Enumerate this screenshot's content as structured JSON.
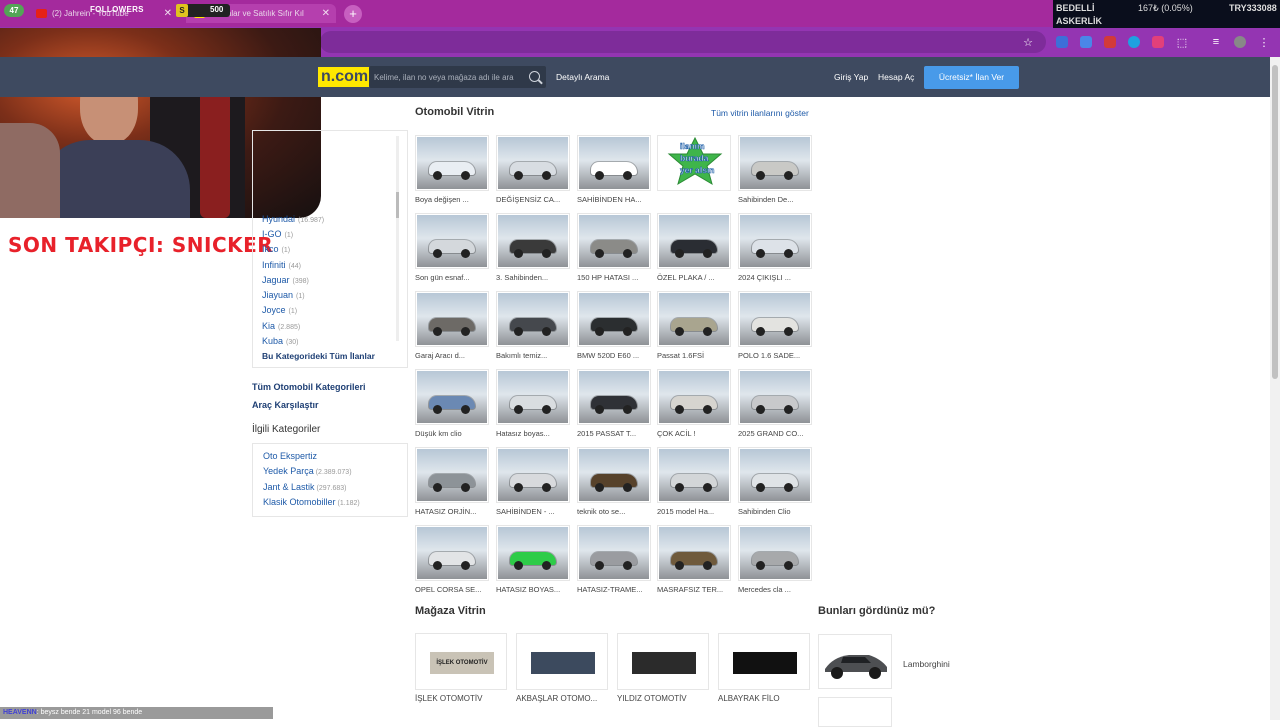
{
  "browser": {
    "tabs": [
      {
        "title": "(2) Jahrein - YouTube",
        "favicon_color": "#e62117"
      },
      {
        "title": "Arabalar ve Satılık Sıfır Kıl",
        "favicon_color": "#ffe800"
      }
    ],
    "new_tab_label": "+",
    "tab_close_label": "✕"
  },
  "overlay": {
    "followers_count": "47",
    "followers_label": "FOLLOWERS",
    "goal_icon_label": "S",
    "goal_value": "500",
    "ticker": {
      "name_line1": "BEDELLİ",
      "name_line2": "ASKERLİK",
      "change": "167₺ (0.05%)",
      "price": "TRY333088"
    },
    "last_follower": "SON TAKIPÇI: SNICKER",
    "chat": {
      "user": "HEAVENN",
      "message": ": beysz bende 21 model 96 bende"
    }
  },
  "header": {
    "logo_text": "n.com",
    "search_placeholder": "Kelime, ilan no veya mağaza adı ile ara",
    "detailed_search": "Detaylı Arama",
    "login": "Giriş Yap",
    "register": "Hesap Aç",
    "post_ad": "Ücretsiz* İlan Ver",
    "brand_color": "#ffe800",
    "header_color": "#3e4a60",
    "cta_color": "#489ae9"
  },
  "sidebar": {
    "categories": [
      {
        "name": "Hyundai",
        "count": "(16.987)"
      },
      {
        "name": "I-GO",
        "count": "(1)"
      },
      {
        "name": "Ikco",
        "count": "(1)"
      },
      {
        "name": "Infiniti",
        "count": "(44)"
      },
      {
        "name": "Jaguar",
        "count": "(398)"
      },
      {
        "name": "Jiayuan",
        "count": "(1)"
      },
      {
        "name": "Joyce",
        "count": "(1)"
      },
      {
        "name": "Kia",
        "count": "(2.885)"
      },
      {
        "name": "Kuba",
        "count": "(30)"
      }
    ],
    "all_in_category": "Bu Kategorideki Tüm İlanlar",
    "all_auto_categories": "Tüm Otomobil Kategorileri",
    "compare_cars": "Araç Karşılaştır",
    "related_heading": "İlgili Kategoriler",
    "related": [
      {
        "name": "Oto Ekspertiz",
        "count": ""
      },
      {
        "name": "Yedek Parça",
        "count": "(2.389.073)"
      },
      {
        "name": "Jant & Lastik",
        "count": "(297.683)"
      },
      {
        "name": "Klasik Otomobiller",
        "count": "(1.182)"
      }
    ]
  },
  "vitrin": {
    "title": "Otomobil Vitrin",
    "show_all": "Tüm vitrin ilanlarını göster",
    "ad_placeholder": {
      "line1": "ilanım",
      "line2": "burada",
      "line3": "yer alsın"
    },
    "listings": [
      {
        "caption": "Boya değişen ...",
        "color": "#e9eef3"
      },
      {
        "caption": "DEĞİŞENSİZ CA...",
        "color": "#d8dde2"
      },
      {
        "caption": "SAHİBİNDEN HA...",
        "color": "#ffffff"
      },
      {
        "caption": "",
        "color": "#ffffff",
        "is_ad": true
      },
      {
        "caption": "Sahibinden De...",
        "color": "#c9c9c6"
      },
      {
        "caption": "Son gün esnaf...",
        "color": "#d4d8dc"
      },
      {
        "caption": "3. Sahibinden...",
        "color": "#3a3a3a"
      },
      {
        "caption": "150 HP HATASI ...",
        "color": "#8b8b88"
      },
      {
        "caption": "ÖZEL PLAKA / ...",
        "color": "#2a2d33"
      },
      {
        "caption": "2024 ÇIKIŞLI ...",
        "color": "#dde2e8"
      },
      {
        "caption": "Garaj Aracı d...",
        "color": "#6d6a66"
      },
      {
        "caption": "Bakımlı temiz...",
        "color": "#45484d"
      },
      {
        "caption": "BMW 520D E60 ...",
        "color": "#2b2e30"
      },
      {
        "caption": "Passat 1.6FSİ",
        "color": "#a9a58f"
      },
      {
        "caption": "POLO 1.6 SADE...",
        "color": "#e3e3e0"
      },
      {
        "caption": "Düşük km clio",
        "color": "#6b89b3"
      },
      {
        "caption": "Hatasız boyas...",
        "color": "#d9dde0"
      },
      {
        "caption": "2015 PASSAT T...",
        "color": "#2f3136"
      },
      {
        "caption": "ÇOK ACİL !",
        "color": "#d6d4cf"
      },
      {
        "caption": "2025 GRAND CO...",
        "color": "#c8c9cb"
      },
      {
        "caption": "HATASIZ ORJİN...",
        "color": "#8d9398"
      },
      {
        "caption": "SAHİBİNDEN - ...",
        "color": "#d8dadd"
      },
      {
        "caption": "teknik oto se...",
        "color": "#57422b"
      },
      {
        "caption": "2015 model Ha...",
        "color": "#d3d6d8"
      },
      {
        "caption": "Sahibinden Clio",
        "color": "#dfe3e6"
      },
      {
        "caption": "OPEL CORSA SE...",
        "color": "#e2e4e6"
      },
      {
        "caption": "HATASIZ BOYAS...",
        "color": "#2ecc48"
      },
      {
        "caption": "HATASIZ-TRAME...",
        "color": "#9a9ca0"
      },
      {
        "caption": "MASRAFSIZ TER...",
        "color": "#6f5a3c"
      },
      {
        "caption": "Mercedes cla ...",
        "color": "#a7a9ab"
      }
    ]
  },
  "shops": {
    "title": "Mağaza Vitrin",
    "items": [
      {
        "name": "İŞLEK OTOMOTİV",
        "banner_text": "İŞLEK OTOMOTİV",
        "color": "#c9c3b6"
      },
      {
        "name": "AKBAŞLAR OTOMO...",
        "banner_text": "",
        "color": "#3c4a5e"
      },
      {
        "name": "YILDIZ OTOMOTİV",
        "banner_text": "",
        "color": "#2b2b2b"
      },
      {
        "name": "ALBAYRAK FİLO",
        "banner_text": "",
        "color": "#111111"
      }
    ]
  },
  "seen": {
    "title": "Bunları gördünüz mü?",
    "items": [
      {
        "name": "Lamborghini"
      }
    ]
  }
}
